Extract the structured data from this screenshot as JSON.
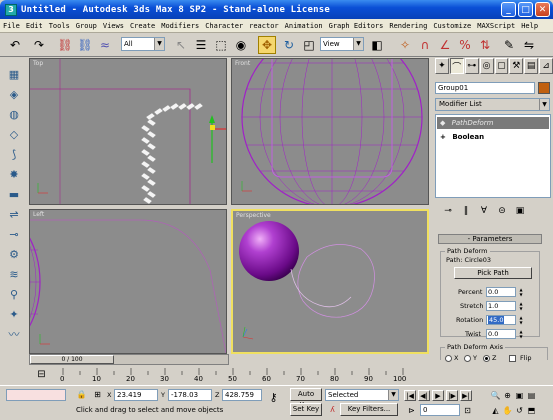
{
  "window": {
    "title": "Untitled - Autodesk 3ds Max 8 SP2 - Stand-alone License",
    "minimize": "_",
    "maximize": "□",
    "close": "✕"
  },
  "menu": [
    "File",
    "Edit",
    "Tools",
    "Group",
    "Views",
    "Create",
    "Modifiers",
    "Character",
    "reactor",
    "Animation",
    "Graph Editors",
    "Rendering",
    "Customize",
    "MAXScript",
    "Help"
  ],
  "toolbar": {
    "selection_filter": "All",
    "ref_coord": "View"
  },
  "viewports": {
    "top": "Top",
    "front": "Front",
    "left": "Left",
    "perspective": "Perspective"
  },
  "timeslider": {
    "frame_label": "0 / 100",
    "current_frame": 0,
    "total_frames": 100
  },
  "ruler": {
    "ticks": [
      "0",
      "10",
      "20",
      "30",
      "40",
      "50",
      "60",
      "70",
      "80",
      "90",
      "100"
    ]
  },
  "status": {
    "x_label": "X",
    "x_value": "23.419",
    "y_label": "Y",
    "y_value": "-178.03",
    "z_label": "Z",
    "z_value": "428.759",
    "prompt": "Click and drag to select and move objects",
    "auto_key": "Auto Key",
    "set_key": "Set Key",
    "key_mode": "Selected",
    "key_filters": "Key Filters...",
    "frame_value": "0"
  },
  "command_panel": {
    "object_name": "Group01",
    "object_color": "#c06010",
    "modifier_list": "Modifier List",
    "stack": [
      {
        "label": "PathDeform",
        "prefix": "◆",
        "selected": true
      },
      {
        "label": "Boolean",
        "prefix": "+",
        "selected": false
      }
    ],
    "rollout_title": "Parameters",
    "path_deform_group": "Path Deform",
    "path_label": "Path: Circle03",
    "pick_path": "Pick Path",
    "percent_label": "Percent",
    "percent_value": "0.0",
    "stretch_label": "Stretch",
    "stretch_value": "1.0",
    "rotation_label": "Rotation",
    "rotation_value": "45.0",
    "twist_label": "Twist",
    "twist_value": "0.0",
    "axis_group": "Path Deform Axis",
    "axis_x": "X",
    "axis_y": "Y",
    "axis_z": "Z",
    "axis_selected": "Z",
    "flip_label": "Flip"
  },
  "colors": {
    "accent_purple": "#a020c8",
    "active_viewport": "#f0e060"
  }
}
